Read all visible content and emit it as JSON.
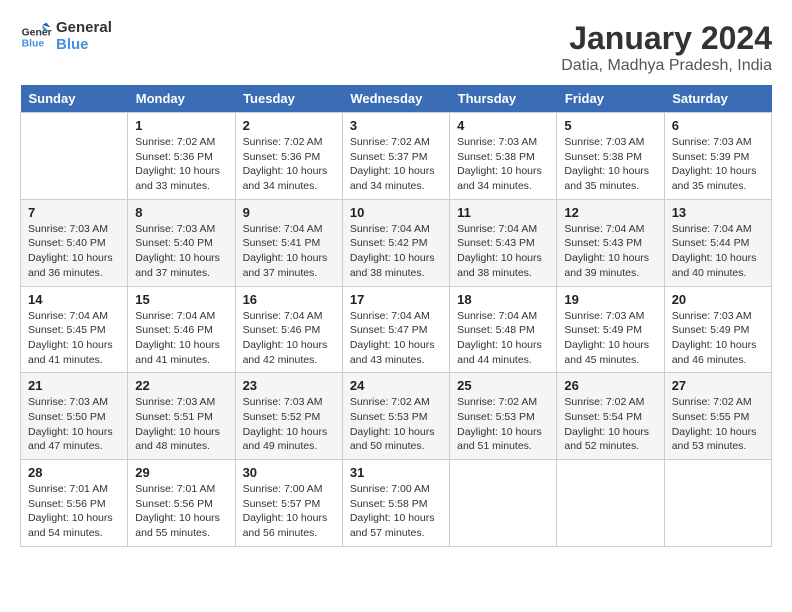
{
  "logo": {
    "line1": "General",
    "line2": "Blue"
  },
  "title": "January 2024",
  "subtitle": "Datia, Madhya Pradesh, India",
  "days_of_week": [
    "Sunday",
    "Monday",
    "Tuesday",
    "Wednesday",
    "Thursday",
    "Friday",
    "Saturday"
  ],
  "weeks": [
    [
      {
        "day": "",
        "info": ""
      },
      {
        "day": "1",
        "info": "Sunrise: 7:02 AM\nSunset: 5:36 PM\nDaylight: 10 hours\nand 33 minutes."
      },
      {
        "day": "2",
        "info": "Sunrise: 7:02 AM\nSunset: 5:36 PM\nDaylight: 10 hours\nand 34 minutes."
      },
      {
        "day": "3",
        "info": "Sunrise: 7:02 AM\nSunset: 5:37 PM\nDaylight: 10 hours\nand 34 minutes."
      },
      {
        "day": "4",
        "info": "Sunrise: 7:03 AM\nSunset: 5:38 PM\nDaylight: 10 hours\nand 34 minutes."
      },
      {
        "day": "5",
        "info": "Sunrise: 7:03 AM\nSunset: 5:38 PM\nDaylight: 10 hours\nand 35 minutes."
      },
      {
        "day": "6",
        "info": "Sunrise: 7:03 AM\nSunset: 5:39 PM\nDaylight: 10 hours\nand 35 minutes."
      }
    ],
    [
      {
        "day": "7",
        "info": "Sunrise: 7:03 AM\nSunset: 5:40 PM\nDaylight: 10 hours\nand 36 minutes."
      },
      {
        "day": "8",
        "info": "Sunrise: 7:03 AM\nSunset: 5:40 PM\nDaylight: 10 hours\nand 37 minutes."
      },
      {
        "day": "9",
        "info": "Sunrise: 7:04 AM\nSunset: 5:41 PM\nDaylight: 10 hours\nand 37 minutes."
      },
      {
        "day": "10",
        "info": "Sunrise: 7:04 AM\nSunset: 5:42 PM\nDaylight: 10 hours\nand 38 minutes."
      },
      {
        "day": "11",
        "info": "Sunrise: 7:04 AM\nSunset: 5:43 PM\nDaylight: 10 hours\nand 38 minutes."
      },
      {
        "day": "12",
        "info": "Sunrise: 7:04 AM\nSunset: 5:43 PM\nDaylight: 10 hours\nand 39 minutes."
      },
      {
        "day": "13",
        "info": "Sunrise: 7:04 AM\nSunset: 5:44 PM\nDaylight: 10 hours\nand 40 minutes."
      }
    ],
    [
      {
        "day": "14",
        "info": "Sunrise: 7:04 AM\nSunset: 5:45 PM\nDaylight: 10 hours\nand 41 minutes."
      },
      {
        "day": "15",
        "info": "Sunrise: 7:04 AM\nSunset: 5:46 PM\nDaylight: 10 hours\nand 41 minutes."
      },
      {
        "day": "16",
        "info": "Sunrise: 7:04 AM\nSunset: 5:46 PM\nDaylight: 10 hours\nand 42 minutes."
      },
      {
        "day": "17",
        "info": "Sunrise: 7:04 AM\nSunset: 5:47 PM\nDaylight: 10 hours\nand 43 minutes."
      },
      {
        "day": "18",
        "info": "Sunrise: 7:04 AM\nSunset: 5:48 PM\nDaylight: 10 hours\nand 44 minutes."
      },
      {
        "day": "19",
        "info": "Sunrise: 7:03 AM\nSunset: 5:49 PM\nDaylight: 10 hours\nand 45 minutes."
      },
      {
        "day": "20",
        "info": "Sunrise: 7:03 AM\nSunset: 5:49 PM\nDaylight: 10 hours\nand 46 minutes."
      }
    ],
    [
      {
        "day": "21",
        "info": "Sunrise: 7:03 AM\nSunset: 5:50 PM\nDaylight: 10 hours\nand 47 minutes."
      },
      {
        "day": "22",
        "info": "Sunrise: 7:03 AM\nSunset: 5:51 PM\nDaylight: 10 hours\nand 48 minutes."
      },
      {
        "day": "23",
        "info": "Sunrise: 7:03 AM\nSunset: 5:52 PM\nDaylight: 10 hours\nand 49 minutes."
      },
      {
        "day": "24",
        "info": "Sunrise: 7:02 AM\nSunset: 5:53 PM\nDaylight: 10 hours\nand 50 minutes."
      },
      {
        "day": "25",
        "info": "Sunrise: 7:02 AM\nSunset: 5:53 PM\nDaylight: 10 hours\nand 51 minutes."
      },
      {
        "day": "26",
        "info": "Sunrise: 7:02 AM\nSunset: 5:54 PM\nDaylight: 10 hours\nand 52 minutes."
      },
      {
        "day": "27",
        "info": "Sunrise: 7:02 AM\nSunset: 5:55 PM\nDaylight: 10 hours\nand 53 minutes."
      }
    ],
    [
      {
        "day": "28",
        "info": "Sunrise: 7:01 AM\nSunset: 5:56 PM\nDaylight: 10 hours\nand 54 minutes."
      },
      {
        "day": "29",
        "info": "Sunrise: 7:01 AM\nSunset: 5:56 PM\nDaylight: 10 hours\nand 55 minutes."
      },
      {
        "day": "30",
        "info": "Sunrise: 7:00 AM\nSunset: 5:57 PM\nDaylight: 10 hours\nand 56 minutes."
      },
      {
        "day": "31",
        "info": "Sunrise: 7:00 AM\nSunset: 5:58 PM\nDaylight: 10 hours\nand 57 minutes."
      },
      {
        "day": "",
        "info": ""
      },
      {
        "day": "",
        "info": ""
      },
      {
        "day": "",
        "info": ""
      }
    ]
  ]
}
